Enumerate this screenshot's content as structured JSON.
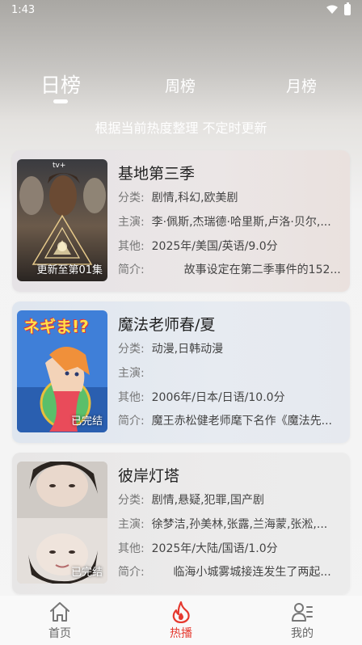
{
  "status_bar": {
    "time": "1:43"
  },
  "tabs": [
    {
      "label": "日榜",
      "active": true
    },
    {
      "label": "周榜",
      "active": false
    },
    {
      "label": "月榜",
      "active": false
    }
  ],
  "subtitle": "根据当前热度整理 不定时更新",
  "labels": {
    "genre": "分类:",
    "cast": "主演:",
    "other": "其他:",
    "intro": "简介:"
  },
  "items": [
    {
      "title": "基地第三季",
      "badge": "更新至第01集",
      "poster_brand": "tv+",
      "genre": "剧情,科幻,欧美剧",
      "cast": "李·佩斯,杰瑞德·哈里斯,卢洛·贝尔,...",
      "other": "2025年/美国/英语/9.0分",
      "intro": "         故事设定在第二季事件的152..."
    },
    {
      "title": "魔法老师春/夏",
      "badge": "已完结",
      "poster_brand": "ネギま!?",
      "genre": "动漫,日韩动漫",
      "cast": "",
      "other": "2006年/日本/日语/10.0分",
      "intro": "魔王赤松健老师麾下名作《魔法先..."
    },
    {
      "title": "彼岸灯塔",
      "badge": "已完结",
      "poster_brand": "",
      "genre": "剧情,悬疑,犯罪,国产剧",
      "cast": "徐梦洁,孙美林,张露,兰海蒙,张淞,...",
      "other": "2025年/大陆/国语/1.0分",
      "intro": "      临海小城雾城接连发生了两起..."
    }
  ],
  "nav": [
    {
      "label": "首页",
      "icon": "home-icon",
      "active": false
    },
    {
      "label": "热播",
      "icon": "flame-icon",
      "active": true
    },
    {
      "label": "我的",
      "icon": "profile-icon",
      "active": false
    }
  ],
  "colors": {
    "accent": "#e5392f"
  }
}
